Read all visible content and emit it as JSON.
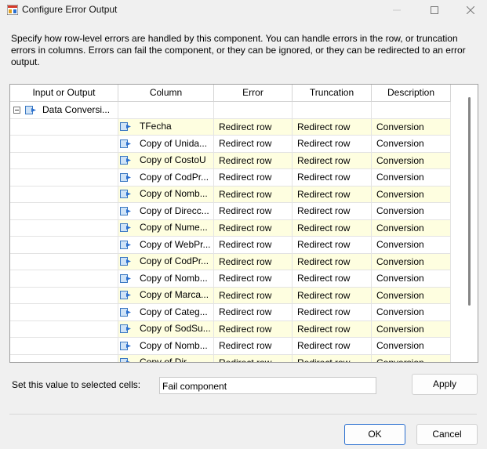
{
  "window": {
    "title": "Configure Error Output",
    "icon": "ssis-component-icon"
  },
  "description": "Specify how row-level errors are handled by this component. You can handle errors in the row, or truncation errors in columns. Errors can fail the component, or they can be ignored, or they can be redirected to an error output.",
  "grid": {
    "headers": {
      "input": "Input or Output",
      "column": "Column",
      "error": "Error",
      "truncation": "Truncation",
      "description": "Description"
    },
    "parent": {
      "label": "Data Conversi...",
      "expanded": true
    },
    "rows": [
      {
        "column": "TFecha",
        "error": "Redirect row",
        "truncation": "Redirect row",
        "description": "Conversion"
      },
      {
        "column": "Copy of Unida...",
        "error": "Redirect row",
        "truncation": "Redirect row",
        "description": "Conversion"
      },
      {
        "column": "Copy of CostoU",
        "error": "Redirect row",
        "truncation": "Redirect row",
        "description": "Conversion"
      },
      {
        "column": "Copy of CodPr...",
        "error": "Redirect row",
        "truncation": "Redirect row",
        "description": "Conversion"
      },
      {
        "column": "Copy of Nomb...",
        "error": "Redirect row",
        "truncation": "Redirect row",
        "description": "Conversion"
      },
      {
        "column": "Copy of Direcc...",
        "error": "Redirect row",
        "truncation": "Redirect row",
        "description": "Conversion"
      },
      {
        "column": "Copy of Nume...",
        "error": "Redirect row",
        "truncation": "Redirect row",
        "description": "Conversion"
      },
      {
        "column": "Copy of WebPr...",
        "error": "Redirect row",
        "truncation": "Redirect row",
        "description": "Conversion"
      },
      {
        "column": "Copy of CodPr...",
        "error": "Redirect row",
        "truncation": "Redirect row",
        "description": "Conversion"
      },
      {
        "column": "Copy of Nomb...",
        "error": "Redirect row",
        "truncation": "Redirect row",
        "description": "Conversion"
      },
      {
        "column": "Copy of Marca...",
        "error": "Redirect row",
        "truncation": "Redirect row",
        "description": "Conversion"
      },
      {
        "column": "Copy of Categ...",
        "error": "Redirect row",
        "truncation": "Redirect row",
        "description": "Conversion"
      },
      {
        "column": "Copy of SodSu...",
        "error": "Redirect row",
        "truncation": "Redirect row",
        "description": "Conversion"
      },
      {
        "column": "Copy of Nomb...",
        "error": "Redirect row",
        "truncation": "Redirect row",
        "description": "Conversion"
      },
      {
        "column": "Copy of Dir...",
        "error": "Redirect row",
        "truncation": "Redirect row",
        "description": "Conversion"
      }
    ]
  },
  "set_value": {
    "label": "Set this value to selected cells:",
    "selected": "Fail component",
    "apply": "Apply"
  },
  "footer": {
    "ok": "OK",
    "cancel": "Cancel"
  },
  "colors": {
    "alt_row": "#fefee0",
    "ok_border": "#2a6fcf"
  }
}
